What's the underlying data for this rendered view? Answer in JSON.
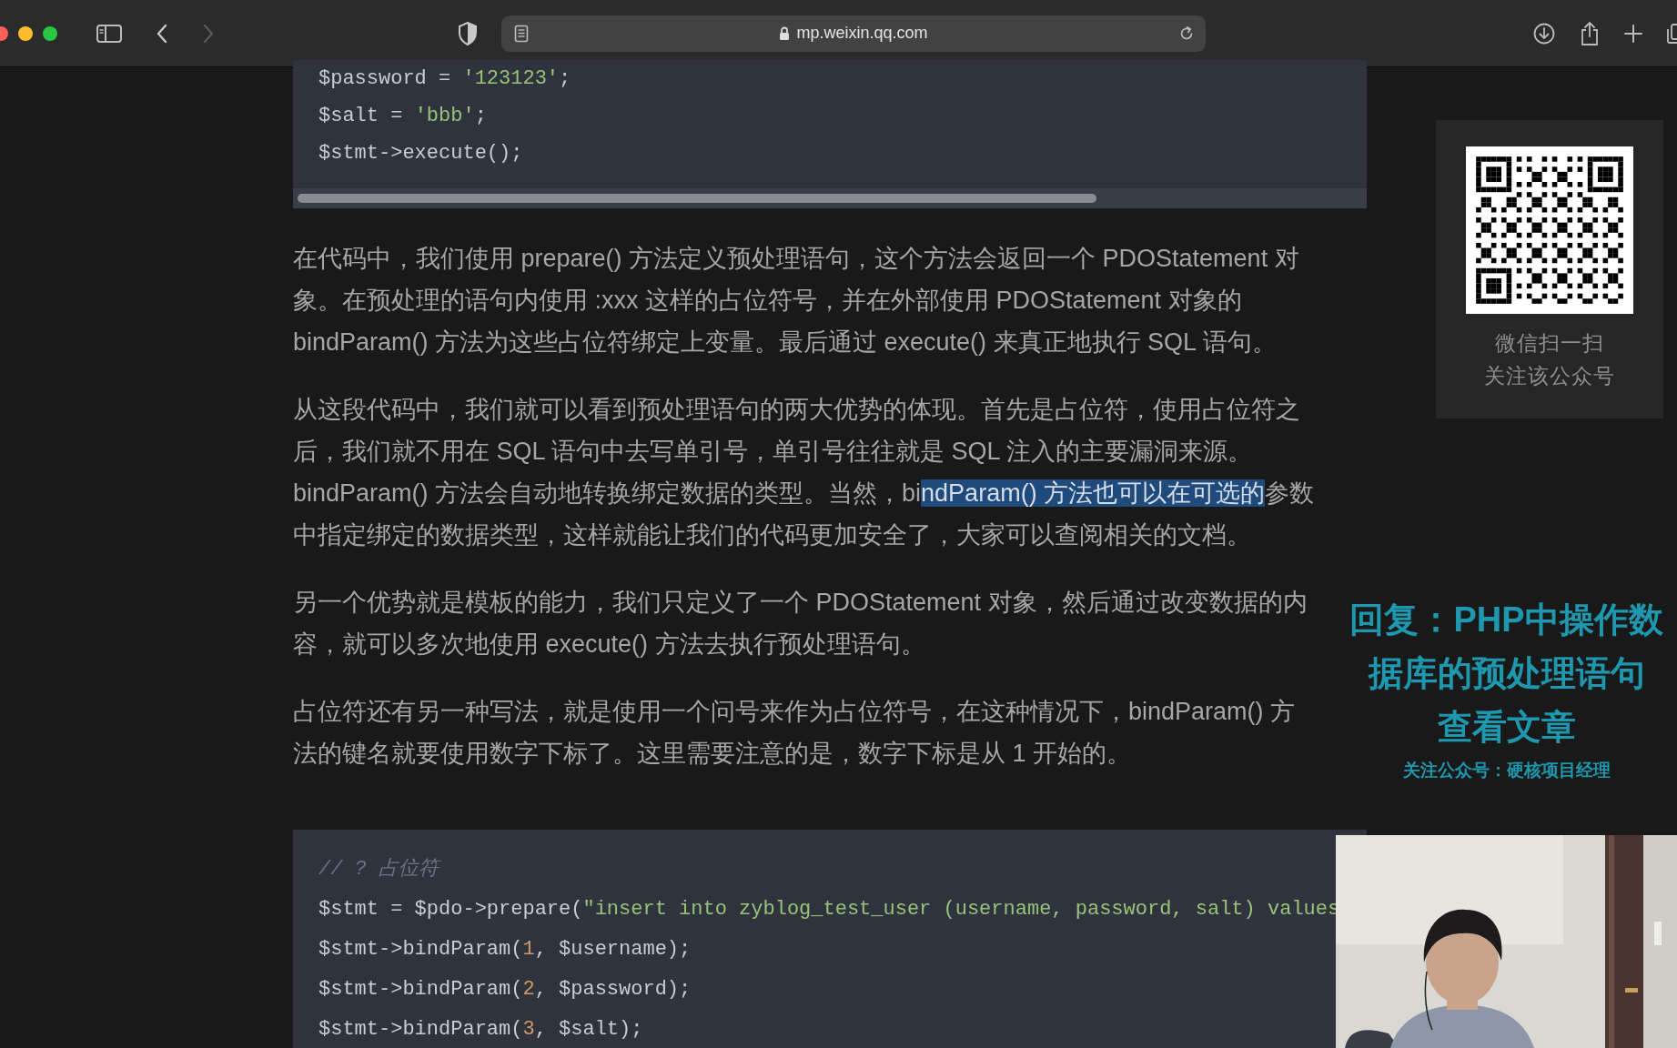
{
  "browser": {
    "url": "mp.weixin.qq.com",
    "back_button": {
      "disabled": false
    },
    "forward_button": {
      "disabled": true
    }
  },
  "article": {
    "blocks": [
      {
        "kind": "code",
        "lines": [
          [
            {
              "kind": "plain",
              "text": "$password = "
            },
            {
              "kind": "string",
              "text": "'123123'"
            },
            {
              "kind": "plain",
              "text": ";"
            }
          ],
          [
            {
              "kind": "plain",
              "text": "$salt = "
            },
            {
              "kind": "string",
              "text": "'bbb'"
            },
            {
              "kind": "plain",
              "text": ";"
            }
          ],
          [
            {
              "kind": "plain",
              "text": "$stmt->execute();"
            }
          ]
        ]
      },
      {
        "kind": "paragraph",
        "lines": [
          [
            {
              "text": "在代码中，我们使用 prepare() 方法定义预处理语句，这个方法会返回一个 PDOStatement 对",
              "selected": false
            }
          ],
          [
            {
              "text": "象。在预处理的语句内使用 :xxx 这样的占位符号，并在外部使用 PDOStatement 对象的",
              "selected": false
            }
          ],
          [
            {
              "text": "bindParam() 方法为这些占位符绑定上变量。最后通过 execute() 来真正地执行 SQL 语句。",
              "selected": false
            }
          ]
        ]
      },
      {
        "kind": "paragraph",
        "lines": [
          [
            {
              "text": "从这段代码中，我们就可以看到预处理语句的两大优势的体现。首先是占位符，使用占位符之",
              "selected": false
            }
          ],
          [
            {
              "text": "后，我们就不用在 SQL 语句中去写单引号，单引号往往就是 SQL 注入的主要漏洞来源。",
              "selected": false
            }
          ],
          [
            {
              "text": "bindParam() 方法会自动地转换绑定数据的类型。当然，bi",
              "selected": false
            },
            {
              "text": "ndParam() 方法也可以在可选的",
              "selected": true
            },
            {
              "text": "参数",
              "selected": false
            }
          ],
          [
            {
              "text": "中指定绑定的数据类型，这样就能让我们的代码更加安全了，大家可以查阅相关的文档。",
              "selected": false
            }
          ]
        ]
      },
      {
        "kind": "paragraph",
        "lines": [
          [
            {
              "text": "另一个优势就是模板的能力，我们只定义了一个 PDOStatement 对象，然后通过改变数据的内",
              "selected": false
            }
          ],
          [
            {
              "text": "容，就可以多次地使用 execute() 方法去执行预处理语句。",
              "selected": false
            }
          ]
        ]
      },
      {
        "kind": "paragraph",
        "lines": [
          [
            {
              "text": "占位符还有另一种写法，就是使用一个问号来作为占位符号，在这种情况下，bindParam() 方",
              "selected": false
            }
          ],
          [
            {
              "text": "法的键名就要使用数字下标了。这里需要注意的是，数字下标是从 1 开始的。",
              "selected": false
            }
          ]
        ]
      },
      {
        "kind": "code",
        "lines": [
          [
            {
              "kind": "comment",
              "text": "// ? 占位符"
            }
          ],
          [
            {
              "kind": "plain",
              "text": "$stmt = $pdo->prepare("
            },
            {
              "kind": "string",
              "text": "\"insert into zyblog_test_user (username, password, salt) values"
            }
          ],
          [
            {
              "kind": "plain",
              "text": "$stmt->bindParam("
            },
            {
              "kind": "number",
              "text": "1"
            },
            {
              "kind": "plain",
              "text": ", $username);"
            }
          ],
          [
            {
              "kind": "plain",
              "text": "$stmt->bindParam("
            },
            {
              "kind": "number",
              "text": "2"
            },
            {
              "kind": "plain",
              "text": ", $password);"
            }
          ],
          [
            {
              "kind": "plain",
              "text": "$stmt->bindParam("
            },
            {
              "kind": "number",
              "text": "3"
            },
            {
              "kind": "plain",
              "text": ", $salt);"
            }
          ]
        ]
      }
    ]
  },
  "qr_panel": {
    "captions": [
      "微信扫一扫",
      "关注该公众号"
    ]
  },
  "video_overlay": {
    "title_lines": [
      "回复：PHP中操作数",
      "据库的预处理语句",
      "查看文章"
    ],
    "subtitle": "关注公众号：硬核项目经理"
  }
}
